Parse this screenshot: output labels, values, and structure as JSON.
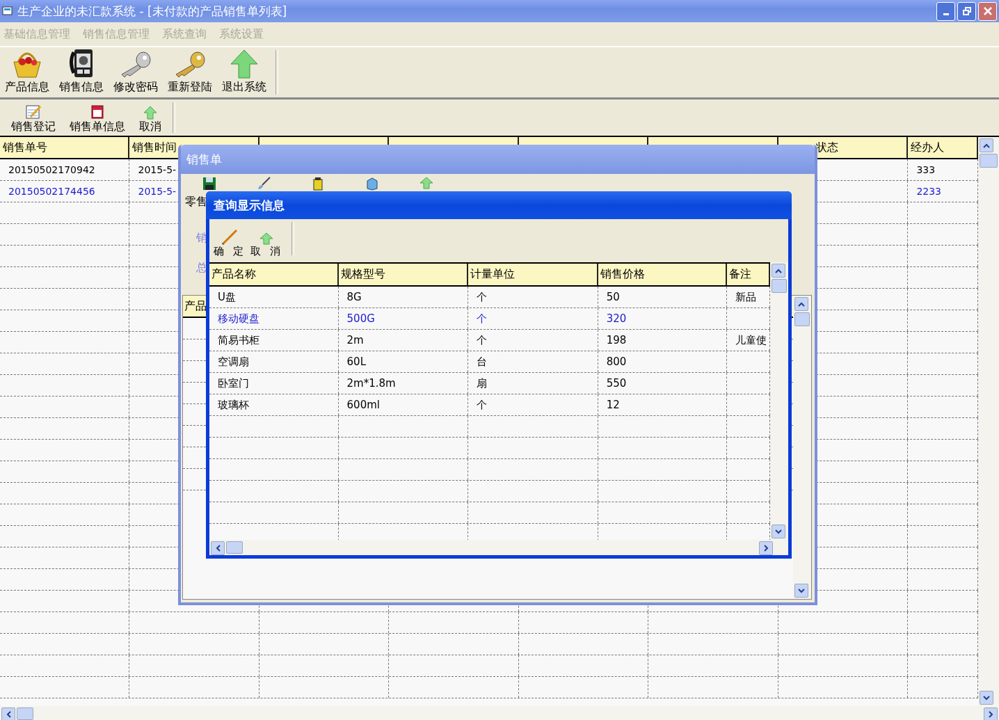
{
  "window": {
    "title": "生产企业的未汇款系统 - [未付款的产品销售单列表]"
  },
  "menu": [
    {
      "label": "基础信息管理",
      "disabled": true
    },
    {
      "label": "销售信息管理",
      "disabled": true
    },
    {
      "label": "系统查询",
      "disabled": true
    },
    {
      "label": "系统设置",
      "disabled": true
    }
  ],
  "toolbar": [
    {
      "label": "产品信息",
      "kind": "basket"
    },
    {
      "label": "销售信息",
      "kind": "phone"
    },
    {
      "label": "修改密码",
      "kind": "silverkey"
    },
    {
      "label": "重新登陆",
      "kind": "goldkey"
    },
    {
      "label": "退出系统",
      "kind": "arrow"
    }
  ],
  "subtoolbar": [
    {
      "label": "销售登记",
      "kind": "notepad"
    },
    {
      "label": "销售单信息",
      "kind": "notebook"
    },
    {
      "label": "取消",
      "kind": "arrow"
    }
  ],
  "table": {
    "columns": [
      "销售单号",
      "销售时间"
    ],
    "status_column": "状态",
    "handler_column": "经办人",
    "rows": [
      {
        "order_no": "20150502170942",
        "time": "2015-5-",
        "handler": "333",
        "selected": false
      },
      {
        "order_no": "20150502174456",
        "time": "2015-5-",
        "handler": "2233",
        "selected": true
      }
    ]
  },
  "order_dialog": {
    "title": "销售单",
    "tools": [
      {
        "kind": "disk"
      },
      {
        "kind": "brush"
      },
      {
        "kind": "jar"
      },
      {
        "kind": "box"
      },
      {
        "kind": "arrow"
      }
    ],
    "tool_label": "零售",
    "field_labels": [
      "销",
      "总"
    ],
    "grid_header": "产品"
  },
  "query_dialog": {
    "title": "查询显示信息",
    "buttons": [
      {
        "label": "确 定",
        "kind": "pencil"
      },
      {
        "label": "取 消",
        "kind": "arrow"
      }
    ],
    "columns": [
      "产品名称",
      "规格型号",
      "计量单位",
      "销售价格",
      "备注"
    ],
    "rows": [
      {
        "cells": [
          "U盘",
          "8G",
          "个",
          "50",
          "新品"
        ],
        "selected": false
      },
      {
        "cells": [
          "移动硬盘",
          "500G",
          "个",
          "320",
          ""
        ],
        "selected": true
      },
      {
        "cells": [
          "简易书柜",
          "2m",
          "个",
          "198",
          "儿童使"
        ],
        "selected": false
      },
      {
        "cells": [
          "空调扇",
          "60L",
          "台",
          "800",
          ""
        ],
        "selected": false
      },
      {
        "cells": [
          "卧室门",
          "2m*1.8m",
          "扇",
          "550",
          ""
        ],
        "selected": false
      },
      {
        "cells": [
          "玻璃杯",
          "600ml",
          "个",
          "12",
          ""
        ],
        "selected": false
      }
    ]
  }
}
